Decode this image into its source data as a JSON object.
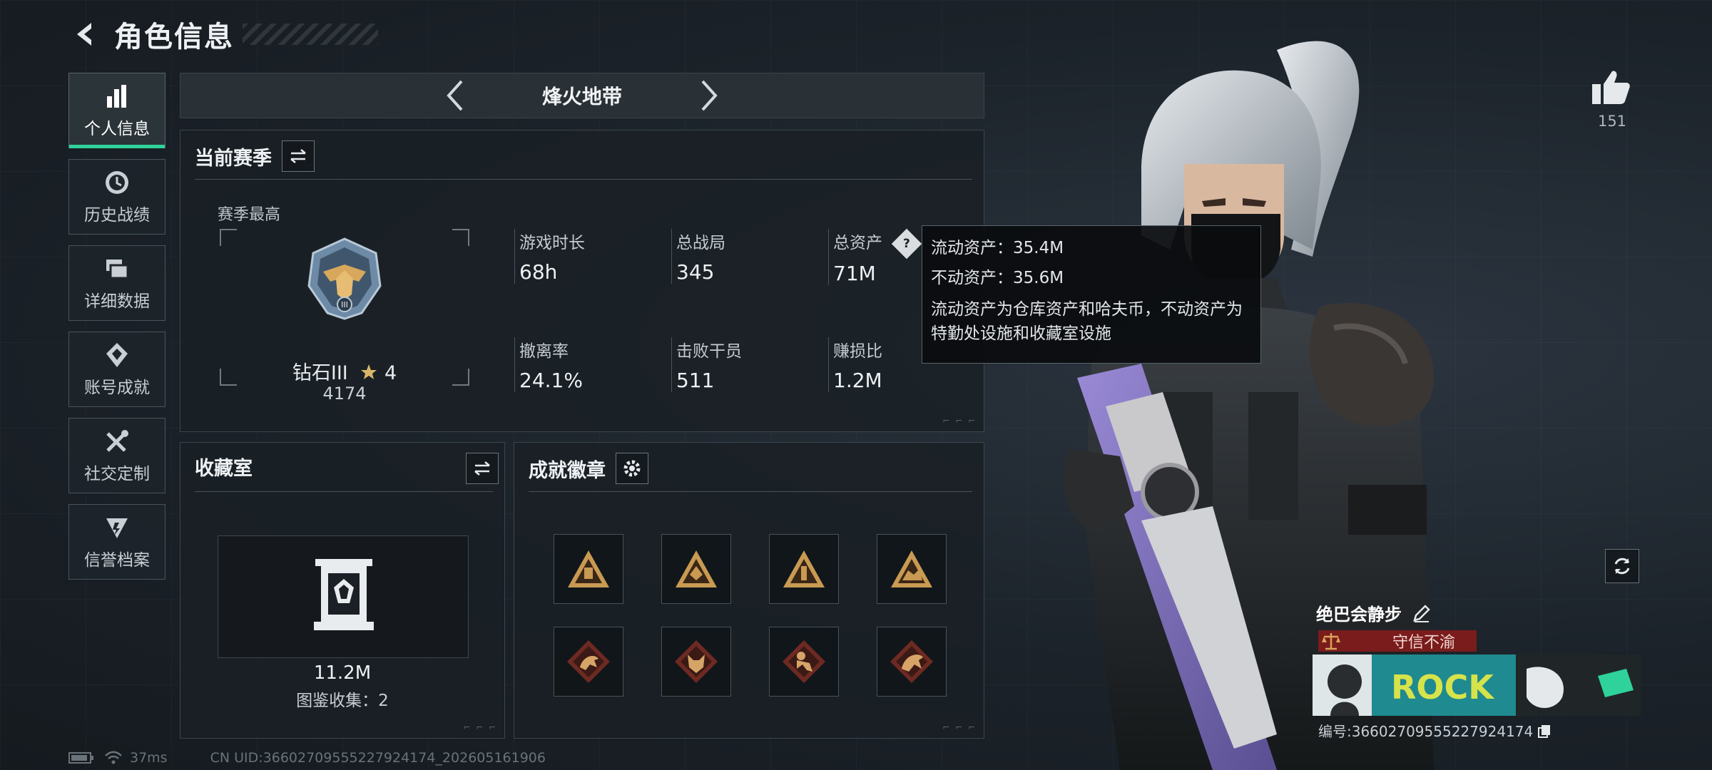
{
  "header": {
    "title": "角色信息"
  },
  "nav": {
    "items": [
      {
        "label": "个人信息",
        "icon": "bar-chart-icon",
        "active": true
      },
      {
        "label": "历史战绩",
        "icon": "history-icon"
      },
      {
        "label": "详细数据",
        "icon": "cards-icon"
      },
      {
        "label": "账号成就",
        "icon": "achievement-icon"
      },
      {
        "label": "社交定制",
        "icon": "tools-icon"
      },
      {
        "label": "信誉档案",
        "icon": "reputation-icon"
      }
    ]
  },
  "mode": {
    "title": "烽火地带"
  },
  "season": {
    "title": "当前赛季",
    "best_label": "赛季最高",
    "rank_name": "钻石III",
    "rank_stars": "4",
    "rank_score": "4174",
    "stats": [
      {
        "label": "游戏时长",
        "value": "68h"
      },
      {
        "label": "总战局",
        "value": "345"
      },
      {
        "label": "总资产",
        "value": "71M"
      },
      {
        "label": "撤离率",
        "value": "24.1%"
      },
      {
        "label": "击败干员",
        "value": "511"
      },
      {
        "label": "赚损比",
        "value": "1.2M"
      }
    ],
    "help_icon": "?"
  },
  "tooltip": {
    "liquid": "流动资产：35.4M",
    "fixed": "不动资产：35.6M",
    "description": "流动资产为仓库资产和哈夫币，不动资产为特勤处设施和收藏室设施"
  },
  "collection": {
    "title": "收藏室",
    "value": "11.2M",
    "count": "图鉴收集：2"
  },
  "achievements": {
    "title": "成就徽章"
  },
  "likes": {
    "count": "151"
  },
  "player": {
    "name": "绝巴会静步",
    "honor": "守信不渝",
    "id": "编号:36602709555227924174",
    "banner_text": "ROCK"
  },
  "footer": {
    "ping": "37ms",
    "uid": "CN UID:36602709555227924174_202605161906"
  },
  "colors": {
    "accent": "#2fd29a",
    "honor": "#7a1c1c",
    "badge_gold": "#c89a52"
  }
}
